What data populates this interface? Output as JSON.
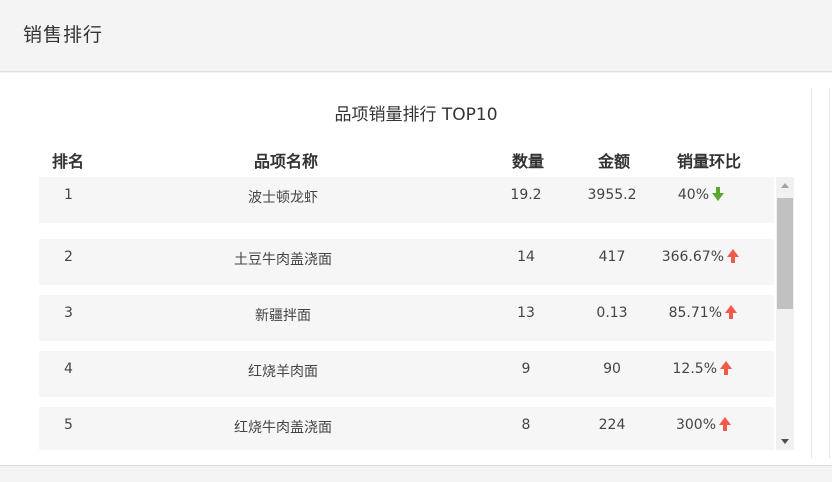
{
  "header": {
    "title": "销售排行"
  },
  "chart": {
    "title": "品项销量排行 TOP10"
  },
  "colors": {
    "up": "#f05a4a",
    "down": "#5aa733"
  },
  "table": {
    "columns": {
      "rank": "排名",
      "name": "品项名称",
      "qty": "数量",
      "amount": "金额",
      "change": "销量环比"
    },
    "rows": [
      {
        "rank": "1",
        "name": "波士顿龙虾",
        "qty": "19.2",
        "amount": "3955.2",
        "change": "40%",
        "trend": "down"
      },
      {
        "rank": "2",
        "name": "土豆牛肉盖浇面",
        "qty": "14",
        "amount": "417",
        "change": "366.67%",
        "trend": "up"
      },
      {
        "rank": "3",
        "name": "新疆拌面",
        "qty": "13",
        "amount": "0.13",
        "change": "85.71%",
        "trend": "up"
      },
      {
        "rank": "4",
        "name": "红烧羊肉面",
        "qty": "9",
        "amount": "90",
        "change": "12.5%",
        "trend": "up"
      },
      {
        "rank": "5",
        "name": "红烧牛肉盖浇面",
        "qty": "8",
        "amount": "224",
        "change": "300%",
        "trend": "up"
      }
    ]
  }
}
